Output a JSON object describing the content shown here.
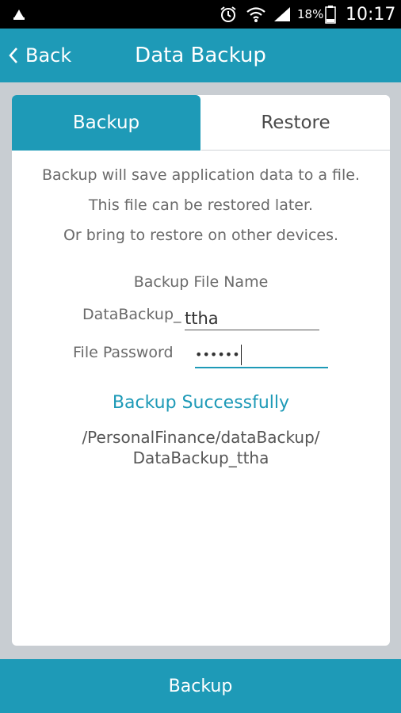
{
  "status_bar": {
    "battery_percent": "18%",
    "time": "10:17",
    "icons": [
      "notification-icon",
      "alarm-icon",
      "wifi-icon",
      "signal-icon",
      "battery-icon"
    ]
  },
  "app_bar": {
    "back_label": "Back",
    "title": "Data Backup"
  },
  "tabs": {
    "backup_label": "Backup",
    "restore_label": "Restore",
    "active": "Backup"
  },
  "description": {
    "line1": "Backup will save application data to a file.",
    "line2": "This file can be restored later.",
    "line3": "Or bring to restore on other devices."
  },
  "form": {
    "file_name_heading": "Backup File Name",
    "file_prefix": "DataBackup_",
    "file_name_value": "ttha",
    "password_label": "File Password",
    "password_value": "••••••"
  },
  "result": {
    "message": "Backup Successfully",
    "path_line1": "/PersonalFinance/dataBackup/",
    "path_line2": "DataBackup_ttha"
  },
  "bottom_button": {
    "label": "Backup"
  },
  "colors": {
    "accent": "#1e9ab7",
    "background": "#c8cdd2"
  }
}
